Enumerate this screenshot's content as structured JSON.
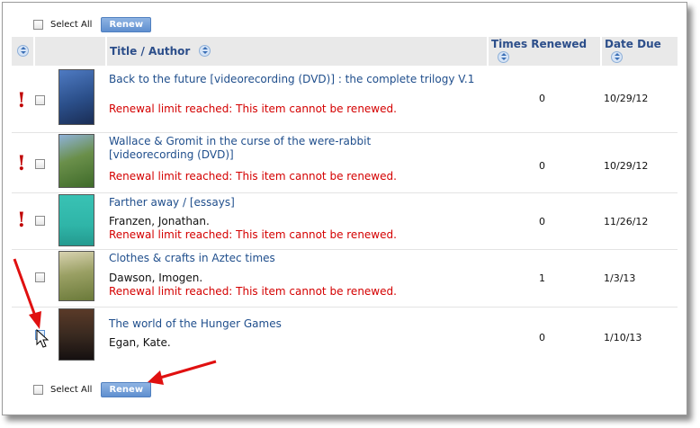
{
  "top_bar": {
    "select_all_label": "Select All",
    "renew_label": "Renew"
  },
  "bottom_bar": {
    "select_all_label": "Select All",
    "renew_label": "Renew"
  },
  "table": {
    "columns": {
      "title_author": "Title / Author",
      "times_renewed": "Times Renewed",
      "date_due": "Date Due"
    },
    "sort_icon": "sort-icon",
    "rows": [
      {
        "title": "Back to the future [videorecording (DVD)] : the complete trilogy V.1",
        "author": "",
        "message": "Renewal limit reached: This item cannot be renewed.",
        "times_renewed": "0",
        "date_due": "10/29/12",
        "alert_icon": "exclamation-icon",
        "cover_color": "#2b4f8a"
      },
      {
        "title": "Wallace & Gromit in the curse of the were-rabbit [videorecording (DVD)]",
        "author": "",
        "message": "Renewal limit reached: This item cannot be renewed.",
        "times_renewed": "0",
        "date_due": "10/29/12",
        "alert_icon": "exclamation-icon",
        "cover_color": "#3f6b2a"
      },
      {
        "title": "Farther away / [essays]",
        "author": "Franzen, Jonathan.",
        "message": "Renewal limit reached: This item cannot be renewed.",
        "times_renewed": "0",
        "date_due": "11/26/12",
        "alert_icon": "exclamation-icon",
        "cover_color": "#2fb5a8"
      },
      {
        "title": "Clothes & crafts in Aztec times",
        "author": "Dawson, Imogen.",
        "message": "Renewal limit reached: This item cannot be renewed.",
        "times_renewed": "1",
        "date_due": "1/3/13",
        "cover_color": "#7c8a4a"
      },
      {
        "title": "The world of the Hunger Games",
        "author": "Egan, Kate.",
        "message": "",
        "times_renewed": "0",
        "date_due": "1/10/13",
        "cover_color": "#3a2a20"
      }
    ]
  },
  "colors": {
    "link": "#1f4e8c",
    "warning": "#d40000",
    "alert": "#c00000",
    "button": "#6b97d3",
    "annotation_arrow": "#e01010"
  }
}
